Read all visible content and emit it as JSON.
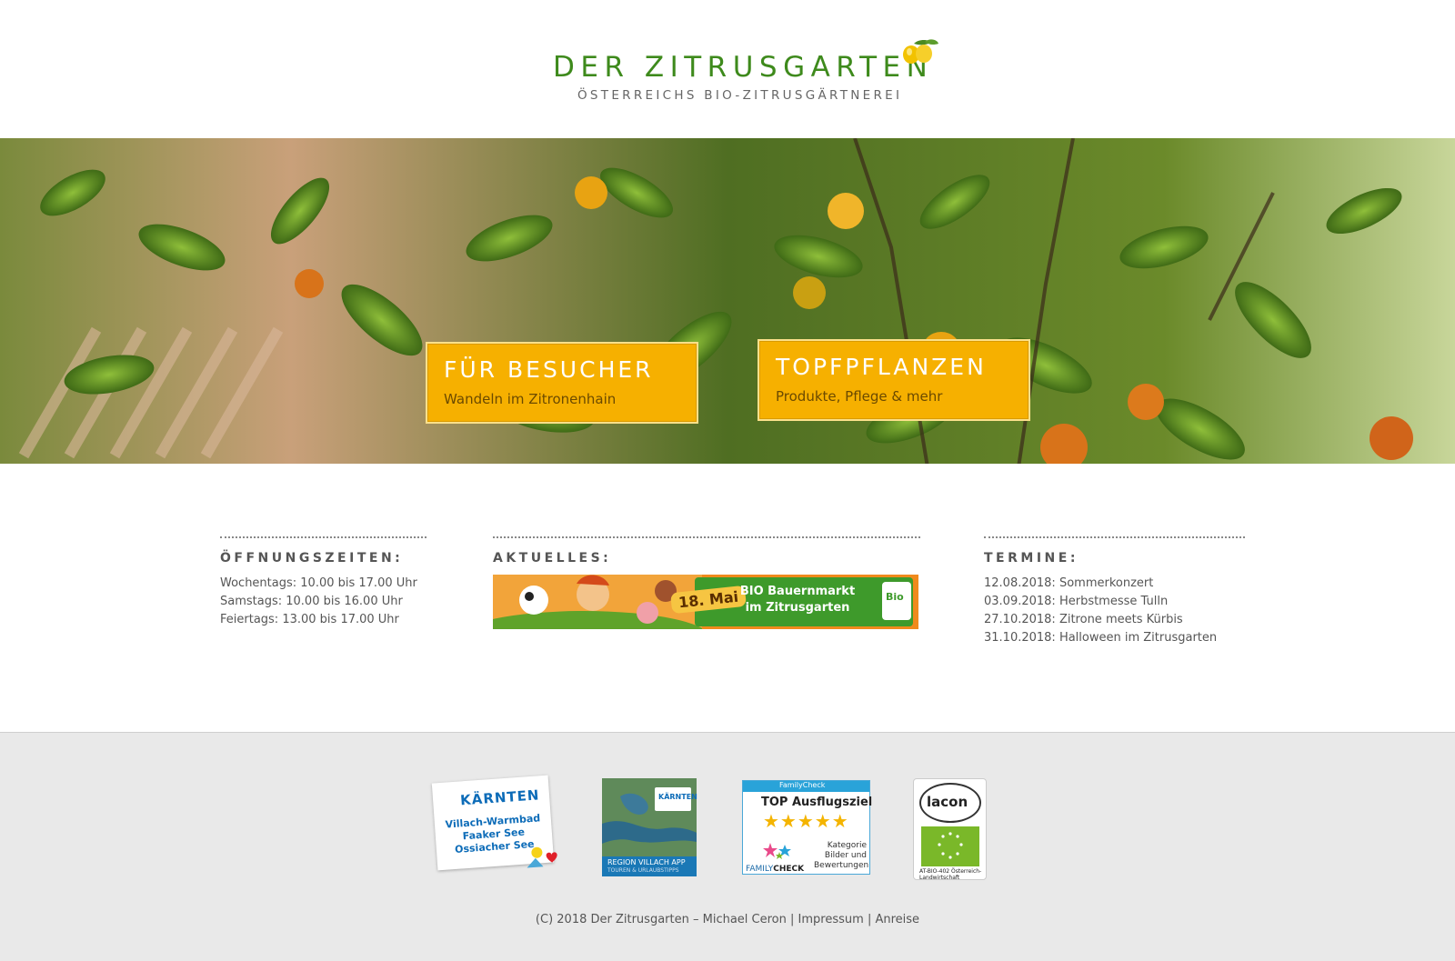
{
  "header": {
    "title": "DER ZITRUSGARTEN",
    "subtitle": "ÖSTERREICHS BIO-ZITRUSGÄRTNEREI"
  },
  "hero": {
    "cta_besucher": {
      "title": "FÜR BESUCHER",
      "subtitle": "Wandeln im Zitronenhain"
    },
    "cta_topf": {
      "title": "TOPFPFLANZEN",
      "subtitle": "Produkte, Pflege & mehr"
    }
  },
  "hours": {
    "heading": "ÖFFNUNGSZEITEN:",
    "lines": [
      "Wochentags: 10.00 bis 17.00 Uhr",
      "Samstags: 10.00 bis 16.00 Uhr",
      "Feiertags: 13.00 bis 17.00 Uhr"
    ]
  },
  "news": {
    "heading": "AKTUELLES:",
    "banner_date": "18. Mai",
    "banner_line1": "BIO Bauernmarkt",
    "banner_line2": "im Zitrusgarten",
    "banner_bio": "Bio"
  },
  "dates": {
    "heading": "TERMINE:",
    "items": [
      "12.08.2018: Sommerkonzert",
      "03.09.2018: Herbstmesse Tulln",
      "27.10.2018: Zitrone meets Kürbis",
      "31.10.2018: Halloween im Zitrusgarten"
    ]
  },
  "badges": {
    "kaernten_logo": "KÄRNTEN",
    "kaernten_text": "Villach-Warmbad Faaker See Ossiacher See",
    "app_logo": "KÄRNTEN",
    "app_title": "REGION VILLACH APP",
    "app_sub": "TOUREN & URLAUBSTIPPS",
    "family_top": "FamilyCheck",
    "family_title": "TOP Ausflugsziel",
    "family_stars": "★★★★★",
    "family_kat": "Kategorie Bilder und Bewertungen",
    "family_brand": "FAMILY",
    "family_brand2": "CHECK",
    "lacon_name": "lacon",
    "lacon_code": "AT-BIO-402 Österreich-Landwirtschaft"
  },
  "footer": {
    "copyright": "(C) 2018 Der Zitrusgarten – Michael Ceron",
    "sep": "|",
    "impressum": "Impressum",
    "anreise": "Anreise"
  },
  "colors": {
    "brand_green": "#3e8a1c",
    "cta_yellow": "#f6b000",
    "footer_bg": "#e9e9e9"
  }
}
